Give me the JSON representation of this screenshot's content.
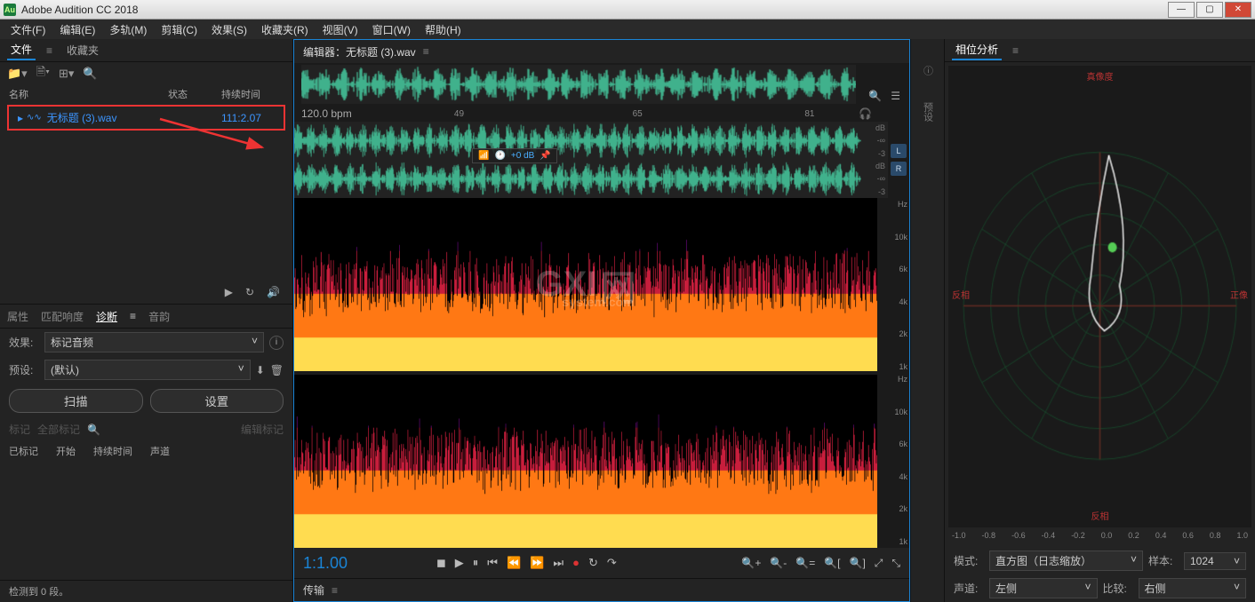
{
  "titlebar": {
    "app_name": "Adobe Audition CC 2018",
    "logo_text": "Au"
  },
  "menubar": [
    "文件(F)",
    "编辑(E)",
    "多轨(M)",
    "剪辑(C)",
    "效果(S)",
    "收藏夹(R)",
    "视图(V)",
    "窗口(W)",
    "帮助(H)"
  ],
  "files_panel": {
    "tabs": {
      "files": "文件",
      "favorites": "收藏夹"
    },
    "columns": {
      "name": "名称",
      "status": "状态",
      "duration": "持续时间"
    },
    "item": {
      "name": "无标题 (3).wav",
      "duration": "111:2.07"
    }
  },
  "props_tabs": {
    "attrs": "属性",
    "match": "匹配响度",
    "diag": "诊断",
    "pitch": "音韵"
  },
  "diag": {
    "effect_label": "效果:",
    "effect_value": "标记音频",
    "preset_label": "预设:",
    "preset_value": "(默认)",
    "scan": "扫描",
    "settings": "设置",
    "marked_label": "已标记",
    "start_label": "开始",
    "duration_label": "持续时间",
    "channel_label": "声道",
    "tags": "标记",
    "alltags": "全部标记",
    "edittag": "编辑标记"
  },
  "status": "检测到 0 段。",
  "editor": {
    "title": "编辑器：无标题 (3).wav",
    "bpm": "120.0 bpm",
    "ticks": [
      "49",
      "65",
      "81"
    ],
    "hud_db": "+0 dB",
    "db_labels": [
      "dB",
      "-∞",
      "-3",
      "dB",
      "-∞",
      "-3"
    ],
    "lr": {
      "L": "L",
      "R": "R"
    },
    "hz_top": [
      "Hz",
      "10k",
      "6k",
      "4k",
      "2k",
      "1k"
    ],
    "hz_bot": [
      "Hz",
      "10k",
      "6k",
      "4k",
      "2k",
      "1k"
    ],
    "timecode": "1:1.00",
    "watermark": "GXI",
    "watermark_sub": "网",
    "watermark_small": "system.com"
  },
  "bottom": {
    "transfer": "传输"
  },
  "rightstrip": {
    "preset": "预设"
  },
  "phase": {
    "title": "相位分析",
    "labels": {
      "top": "真像度",
      "left": "反相",
      "right": "正像",
      "bottom": "反相"
    },
    "axis": [
      "-1.0",
      "-0.8",
      "-0.6",
      "-0.4",
      "-0.2",
      "0.0",
      "0.2",
      "0.4",
      "0.6",
      "0.8",
      "1.0"
    ],
    "mode_label": "模式:",
    "mode_value": "直方图（日志缩放）",
    "samples_label": "样本:",
    "samples_value": "1024",
    "channel_label": "声道:",
    "channel_value": "左侧",
    "compare_label": "比较:",
    "compare_value": "右侧"
  }
}
